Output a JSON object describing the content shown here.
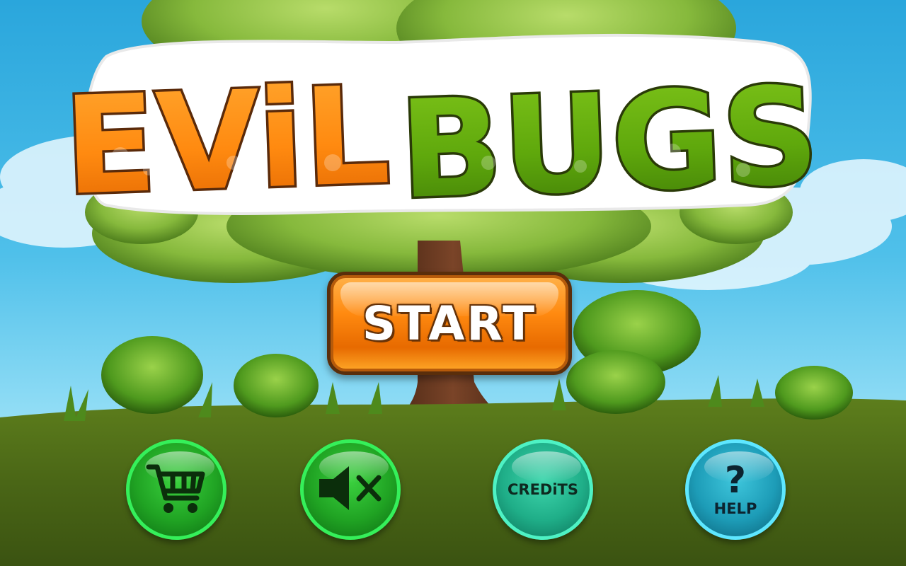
{
  "game": {
    "title_word_1": "EViL",
    "title_word_2": "BUGS"
  },
  "menu": {
    "start_label": "START",
    "shop_icon": "shopping-cart-icon",
    "sound_icon": "speaker-muted-icon",
    "credits_label": "CREDiTS",
    "help_symbol": "?",
    "help_label": "HELP"
  },
  "colors": {
    "title_orange": "#ff8a10",
    "title_green": "#5fa80c",
    "start_orange": "#ff8a10",
    "shop_green": "#20a323",
    "credits_teal": "#1fae88",
    "help_blue": "#1d9cb7"
  }
}
